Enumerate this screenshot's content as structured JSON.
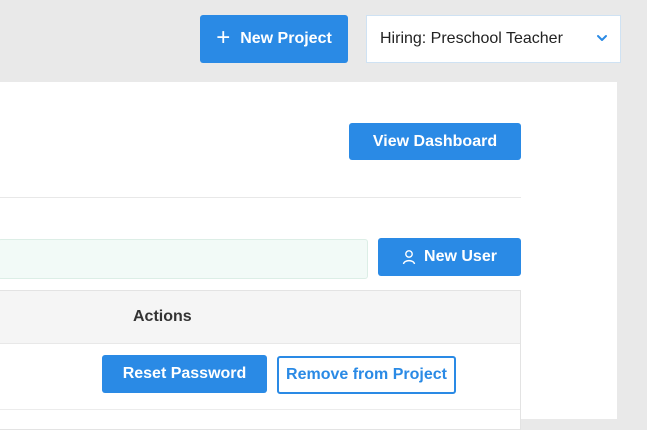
{
  "header": {
    "new_project_label": "New Project",
    "project_select_value": "Hiring: Preschool Teacher"
  },
  "panel": {
    "view_dashboard_label": "View Dashboard"
  },
  "users": {
    "search_value": "",
    "new_user_label": "New User",
    "table": {
      "columns": [
        "Actions"
      ],
      "rows": [
        {
          "actions": {
            "reset_label": "Reset Password",
            "remove_label": "Remove from Project"
          }
        }
      ]
    }
  },
  "colors": {
    "primary": "#2a8ae5",
    "page_background": "#e9e9e9",
    "search_background": "#f2faf7"
  },
  "icons": {
    "new_project": "plus-icon",
    "project_select": "chevron-down-icon",
    "new_user": "user-icon"
  }
}
